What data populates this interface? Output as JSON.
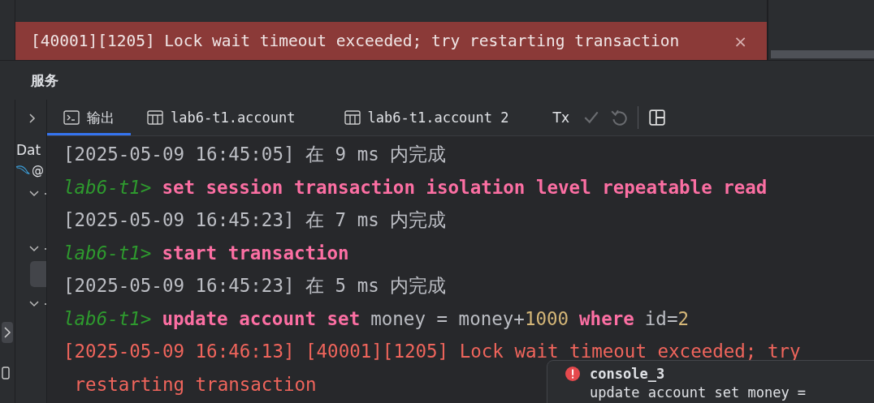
{
  "notification": {
    "message": "[40001][1205] Lock wait timeout exceeded; try restarting transaction",
    "close": "×"
  },
  "panel": {
    "title": "服务"
  },
  "sidebar": {
    "title": "Dat",
    "connection": "@",
    "tree": [
      {
        "expanded": true
      },
      {
        "expanded": true,
        "children": [
          {
            "selected": true
          }
        ]
      },
      {
        "expanded": true
      }
    ]
  },
  "tabs": [
    {
      "label": "输出",
      "selected": true
    },
    {
      "label": "lab6-t1.account",
      "selected": false
    },
    {
      "label": "lab6-t1.account 2",
      "selected": false
    }
  ],
  "toolbar": {
    "tx": "Tx",
    "commit_disabled": true,
    "rollback_disabled": true
  },
  "console": [
    [
      {
        "kind": "plain",
        "text": "[2025-05-09 16:45:05] 在 9 ms 内完成"
      }
    ],
    [
      {
        "kind": "prompt",
        "text": "lab6-t1>"
      },
      {
        "kind": "keyword",
        "text": "set session transaction isolation level repeatable read"
      }
    ],
    [
      {
        "kind": "plain",
        "text": "[2025-05-09 16:45:23] 在 7 ms 内完成"
      }
    ],
    [
      {
        "kind": "prompt",
        "text": "lab6-t1>"
      },
      {
        "kind": "keyword",
        "text": "start transaction"
      }
    ],
    [
      {
        "kind": "plain",
        "text": "[2025-05-09 16:45:23] 在 5 ms 内完成"
      }
    ],
    [
      {
        "kind": "prompt",
        "text": "lab6-t1>"
      },
      {
        "kind": "keyword",
        "text": "update account set"
      },
      {
        "kind": "plain",
        "text": "money = money+"
      },
      {
        "kind": "number",
        "text": "1000"
      },
      {
        "kind": "keyword",
        "text": "where"
      },
      {
        "kind": "plain",
        "text": "id="
      },
      {
        "kind": "number",
        "text": "2"
      }
    ],
    [
      {
        "kind": "error",
        "text": "[2025-05-09 16:46:13] [40001][1205] Lock wait timeout exceeded; try"
      }
    ],
    [
      {
        "kind": "error",
        "text": " restarting transaction"
      }
    ]
  ],
  "popup": {
    "title": "console_3",
    "text": "update account set money ="
  }
}
